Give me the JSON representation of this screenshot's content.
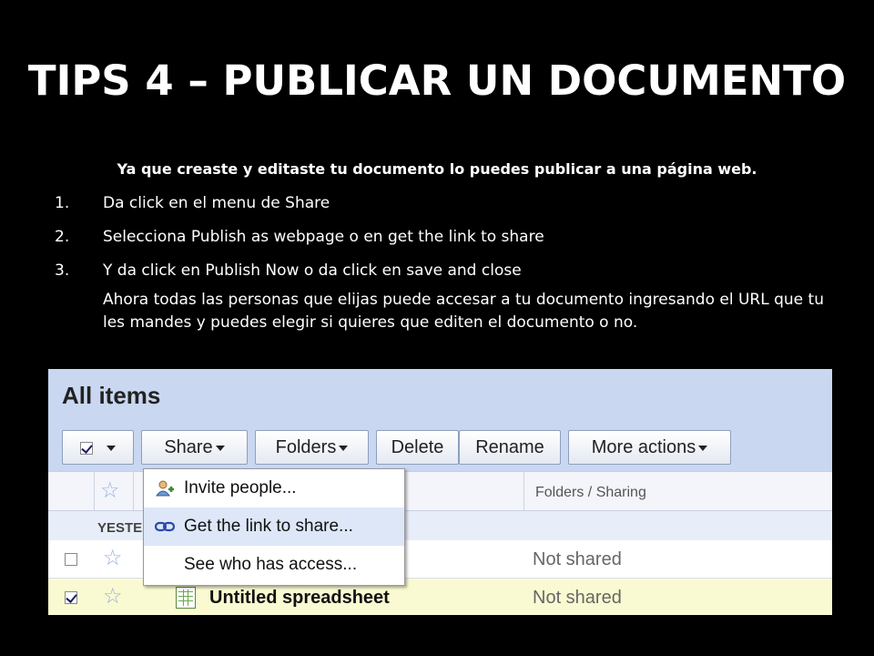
{
  "slide": {
    "title": "TIPS 4 – PUBLICAR UN DOCUMENTO",
    "intro": "Ya que creaste y editaste tu documento lo puedes publicar a una página web.",
    "steps": [
      {
        "num": "1.",
        "text": "Da click en el menu de Share"
      },
      {
        "num": "2.",
        "text": "Selecciona Publish as webpage o en get the link to share"
      },
      {
        "num": "3.",
        "text": "Y da click en Publish Now o da click en save and close"
      }
    ],
    "note": "Ahora todas las personas que elijas puede accesar a tu documento ingresando el URL que tu les mandes y puedes elegir si quieres que editen el documento o no."
  },
  "screenshot": {
    "heading": "All items",
    "toolbar": {
      "share": "Share",
      "folders": "Folders",
      "delete": "Delete",
      "rename": "Rename",
      "more_actions": "More actions"
    },
    "columns": {
      "folders_sharing": "Folders / Sharing"
    },
    "group_label": "YESTE",
    "share_menu": [
      {
        "label": "Invite people...",
        "icon": "invite-people-icon"
      },
      {
        "label": "Get the link to share...",
        "icon": "link-icon",
        "highlighted": true
      },
      {
        "label": "See who has access...",
        "icon": ""
      }
    ],
    "rows": [
      {
        "name": "",
        "status": "Not shared",
        "checked": false
      },
      {
        "name": "Untitled spreadsheet",
        "status": "Not shared",
        "checked": true
      }
    ],
    "colors": {
      "toolbar_bg": "#c9d7f1",
      "selected_row": "#fafad2",
      "menu_highlight": "#dde7f8"
    }
  }
}
